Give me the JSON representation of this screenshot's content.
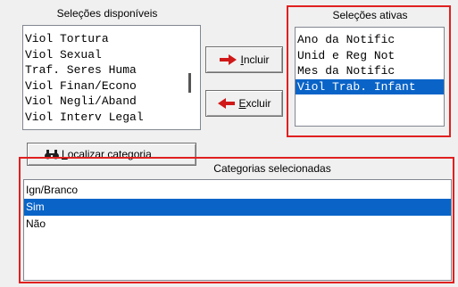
{
  "available": {
    "caption": "Seleções disponíveis",
    "items": [
      "Viol Tortura",
      "Viol Sexual",
      "Traf. Seres Huma",
      "Viol Finan/Econo",
      "Viol Negli/Aband",
      "Viol Interv Legal"
    ]
  },
  "active": {
    "caption": "Seleções ativas",
    "items": [
      "Ano da Notific",
      "Unid e Reg Not",
      "Mes da Notific",
      "Viol Trab. Infant"
    ],
    "selected_index": 3
  },
  "buttons": {
    "include_first": "I",
    "include_rest": "ncluir",
    "exclude_first": "E",
    "exclude_rest": "xcluir",
    "locate_first": "L",
    "locate_rest": "ocalizar categoria"
  },
  "categories": {
    "caption": "Categorias selecionadas",
    "items": [
      "Ign/Branco",
      "Sim",
      "Não"
    ],
    "selected_index": 1
  },
  "colors": {
    "highlight": "#0a64c8",
    "red_outline": "#e02020",
    "arrow_red": "#d01818"
  }
}
